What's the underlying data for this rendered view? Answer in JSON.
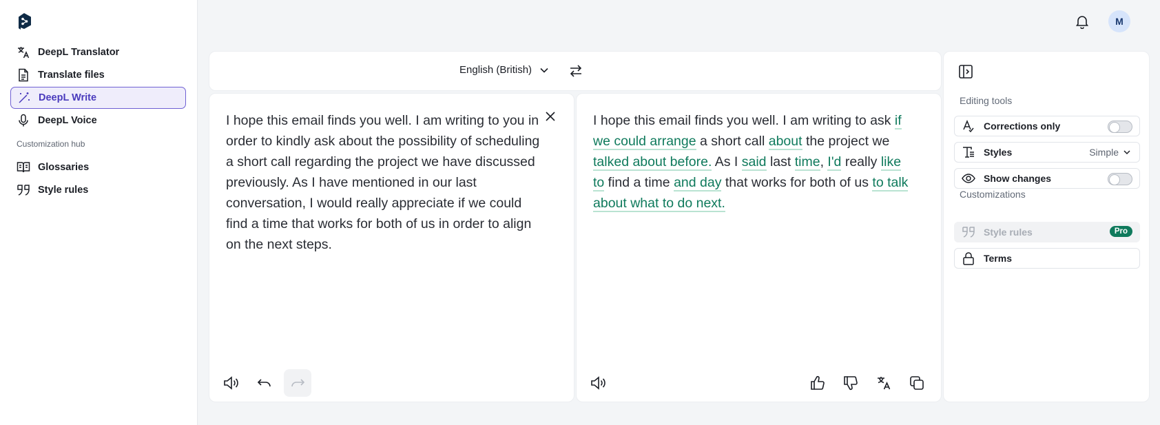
{
  "sidebar": {
    "items": [
      {
        "label": "DeepL Translator",
        "icon": "translate-icon"
      },
      {
        "label": "Translate files",
        "icon": "file-icon"
      },
      {
        "label": "DeepL Write",
        "icon": "magic-wand-icon",
        "active": true
      },
      {
        "label": "DeepL Voice",
        "icon": "microphone-icon"
      }
    ],
    "section_label": "Customization hub",
    "hub_items": [
      {
        "label": "Glossaries",
        "icon": "book-icon"
      },
      {
        "label": "Style rules",
        "icon": "quote-icon"
      }
    ]
  },
  "topbar": {
    "avatar_initial": "M"
  },
  "langbar": {
    "language": "English (British)"
  },
  "source": {
    "text": "I hope this email finds you well. I am writing to you in order to kindly ask about the possibility of scheduling a short call regarding the project we have discussed previously. As I have mentioned in our last conversation, I would really appreciate if we could find a time that works for both of us in order to align on the next steps."
  },
  "output": {
    "segments": [
      {
        "t": "I hope this email finds you well. I am writing to ask ",
        "c": false
      },
      {
        "t": "if we could arrange",
        "c": true
      },
      {
        "t": " a short call ",
        "c": false
      },
      {
        "t": "about",
        "c": true
      },
      {
        "t": " the project we ",
        "c": false
      },
      {
        "t": "talked about before.",
        "c": true
      },
      {
        "t": " As I ",
        "c": false
      },
      {
        "t": "said",
        "c": true
      },
      {
        "t": " last ",
        "c": false
      },
      {
        "t": "time",
        "c": true
      },
      {
        "t": ", ",
        "c": false
      },
      {
        "t": "I'd",
        "c": true
      },
      {
        "t": " really ",
        "c": false
      },
      {
        "t": "like to",
        "c": true
      },
      {
        "t": " find a time ",
        "c": false
      },
      {
        "t": "and day",
        "c": true
      },
      {
        "t": " that works for both of us ",
        "c": false
      },
      {
        "t": "to talk about what to do next.",
        "c": true
      }
    ]
  },
  "tools": {
    "editing_label": "Editing tools",
    "corrections_label": "Corrections only",
    "corrections_on": false,
    "styles_label": "Styles",
    "styles_value": "Simple",
    "show_changes_label": "Show changes",
    "show_changes_on": false,
    "customizations_label": "Customizations",
    "style_rules_label": "Style rules",
    "pro_badge": "Pro",
    "terms_label": "Terms"
  },
  "colors": {
    "accent": "#4a3bbd",
    "change": "#0f7a5c",
    "change_underline": "#b9e3d2",
    "logo": "#0f2b46"
  }
}
